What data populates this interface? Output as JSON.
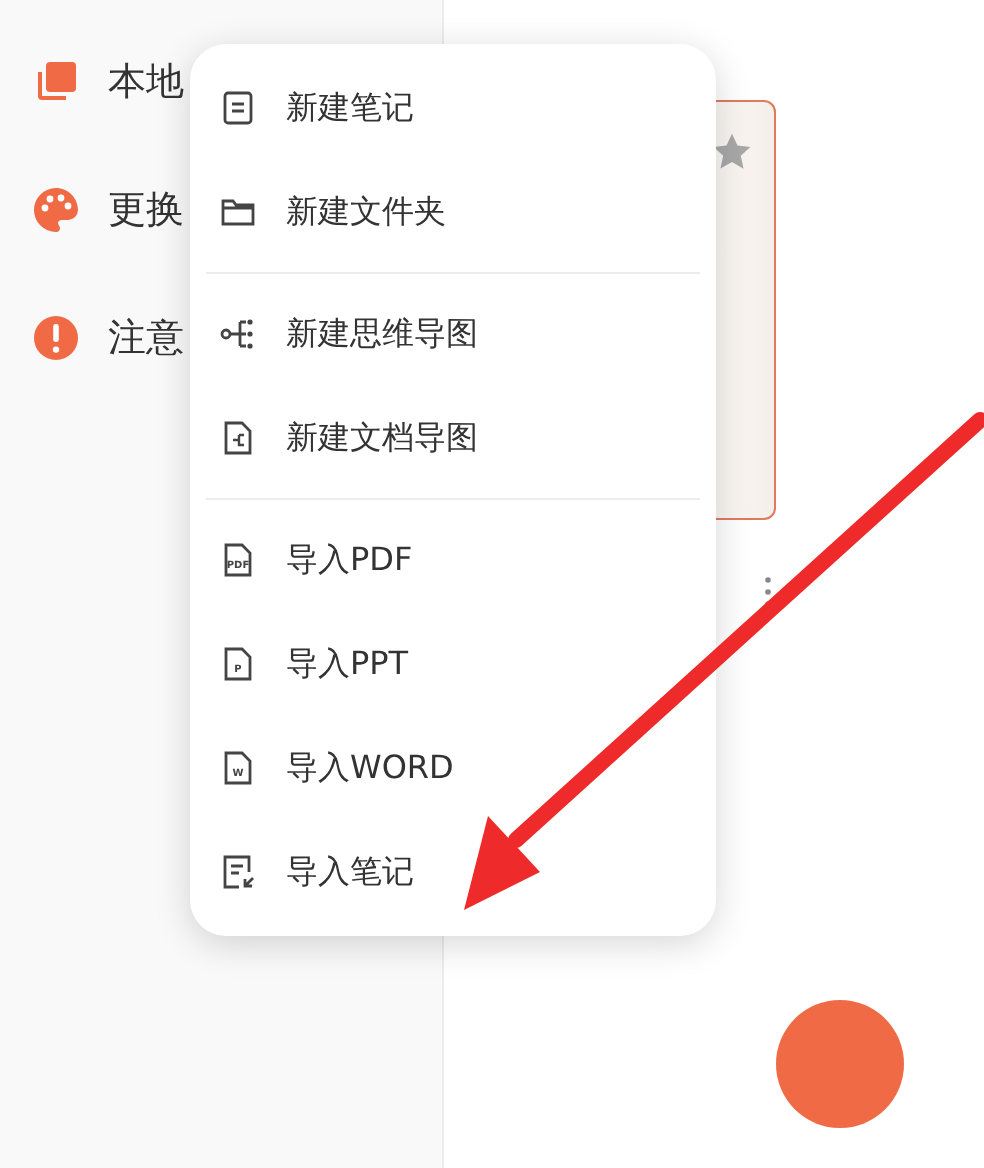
{
  "sidebar": {
    "items": [
      {
        "label": "本地",
        "kind": "local"
      },
      {
        "label": "更换",
        "kind": "theme"
      },
      {
        "label": "注意",
        "kind": "notice"
      }
    ]
  },
  "note_card": {
    "starred": true
  },
  "menu": {
    "groups": [
      [
        {
          "label": "新建笔记",
          "kind": "note"
        },
        {
          "label": "新建文件夹",
          "kind": "folder"
        }
      ],
      [
        {
          "label": "新建思维导图",
          "kind": "mindmap"
        },
        {
          "label": "新建文档导图",
          "kind": "docmap"
        }
      ],
      [
        {
          "label": "导入PDF",
          "kind": "file",
          "icon_text": "PDF"
        },
        {
          "label": "导入PPT",
          "kind": "file",
          "icon_text": "P"
        },
        {
          "label": "导入WORD",
          "kind": "file",
          "icon_text": "W"
        },
        {
          "label": "导入笔记",
          "kind": "import"
        }
      ]
    ]
  }
}
